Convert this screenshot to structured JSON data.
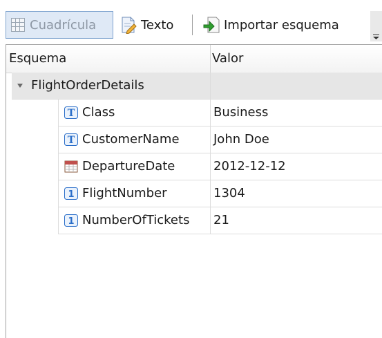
{
  "toolbar": {
    "grid_label": "Cuadrícula",
    "text_label": "Texto",
    "import_label": "Importar esquema"
  },
  "grid": {
    "columns": {
      "schema": "Esquema",
      "value": "Valor"
    },
    "root": {
      "label": "FlightOrderDetails"
    },
    "fields": [
      {
        "name": "Class",
        "value": "Business",
        "type_icon": "text-type-icon"
      },
      {
        "name": "CustomerName",
        "value": "John Doe",
        "type_icon": "text-type-icon"
      },
      {
        "name": "DepartureDate",
        "value": "2012-12-12",
        "type_icon": "calendar-type-icon"
      },
      {
        "name": "FlightNumber",
        "value": "1304",
        "type_icon": "number-type-icon"
      },
      {
        "name": "NumberOfTickets",
        "value": "21",
        "type_icon": "number-type-icon"
      }
    ]
  },
  "colors": {
    "selected_button_bg": "#dfe9f6",
    "selected_button_border": "#7da2ce",
    "parent_row_bg": "#e6e6e6",
    "icon_blue": "#2a6ec9",
    "import_arrow_green": "#2e9d2e"
  }
}
